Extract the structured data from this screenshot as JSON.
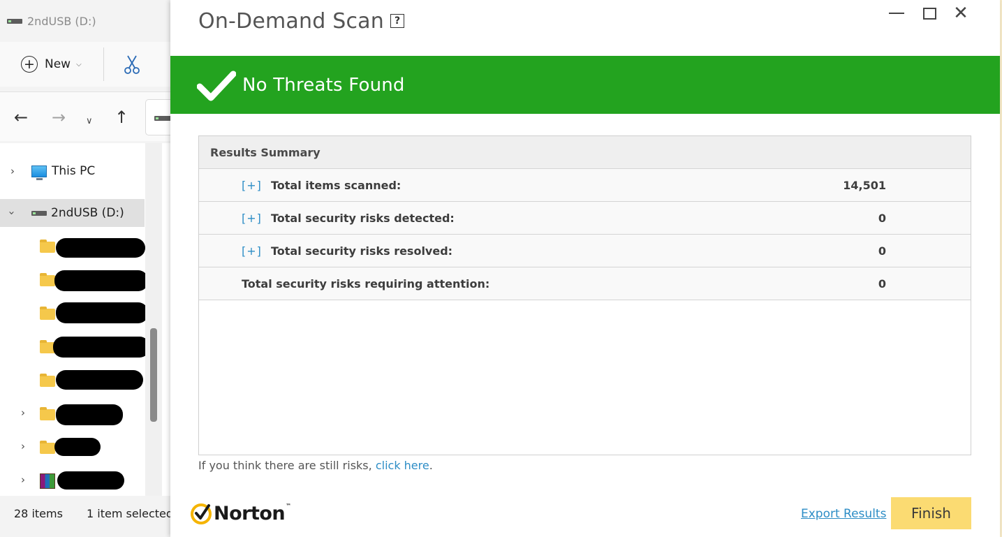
{
  "explorer": {
    "title": "2ndUSB (D:)",
    "new_label": "New",
    "tree": {
      "this_pc_label": "This PC",
      "drive_label": "2ndUSB (D:)"
    },
    "status": {
      "item_count": "28 items",
      "selection": "1 item selected"
    }
  },
  "dialog": {
    "title": "On-Demand Scan",
    "help_glyph": "?",
    "window_controls": {
      "close_glyph": "✕"
    },
    "banner": {
      "text": "No Threats Found",
      "color": "#23a31f"
    },
    "results": {
      "header": "Results Summary",
      "rows": [
        {
          "expand": "[+]",
          "label": "Total items scanned:",
          "value": "14,501"
        },
        {
          "expand": "[+]",
          "label": "Total security risks detected:",
          "value": "0"
        },
        {
          "expand": "[+]",
          "label": "Total security risks resolved:",
          "value": "0"
        },
        {
          "expand": "",
          "label": "Total security risks requiring attention:",
          "value": "0"
        }
      ]
    },
    "note": {
      "prefix": "If you think there are still risks,",
      "link": "click here",
      "suffix": "."
    },
    "brand": {
      "name": "Norton",
      "tm": "™",
      "badge_color": "#f5b400"
    },
    "export_label": "Export Results",
    "finish_label": "Finish",
    "finish_color": "#fbdb72",
    "link_color": "#2d8dc6"
  }
}
